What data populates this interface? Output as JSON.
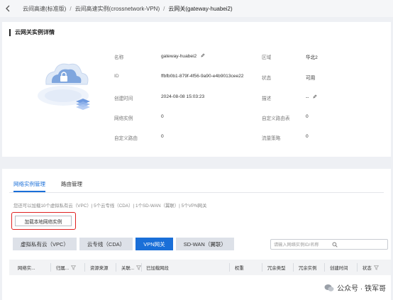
{
  "breadcrumb": {
    "items": [
      "云间高速(标准版)",
      "云间高速实例(crossnetwork-VPN)",
      "云网关(gateway-huabei2)"
    ],
    "separator": "/"
  },
  "details": {
    "title": "云网关实例详情",
    "fields": {
      "name": {
        "label": "名称",
        "value": "gateway-huabei2"
      },
      "region": {
        "label": "区域",
        "value": "华北2"
      },
      "id": {
        "label": "ID",
        "value": "ffbfb0b1-879f-4f56-9a90-e4b9013cee22"
      },
      "status": {
        "label": "状态",
        "value": "可用"
      },
      "created": {
        "label": "创建时间",
        "value": "2024-08-08 15:03:23"
      },
      "desc": {
        "label": "描述",
        "value": "--"
      },
      "net_instance": {
        "label": "网络实例",
        "value": "0"
      },
      "custom_route_table": {
        "label": "自定义路由表",
        "value": "0"
      },
      "custom_route": {
        "label": "自定义路由",
        "value": "0"
      },
      "flow_policy": {
        "label": "流量策略",
        "value": "0"
      }
    }
  },
  "tabs": [
    {
      "label": "网络实例管理",
      "active": true
    },
    {
      "label": "路由管理",
      "active": false
    }
  ],
  "quota_text": "您还可以加载10个虚拟私有云（VPC）| 5个云专线（CDA）| 1个SD-WAN（翼联）| 5个VPN网关",
  "add_button": "加载本地网络实例",
  "filters": [
    {
      "label": "虚拟私有云（VPC）",
      "active": false
    },
    {
      "label": "云专线（CDA）",
      "active": false
    },
    {
      "label": "VPN网关",
      "active": true
    },
    {
      "label": "SD-WAN（翼联）",
      "active": false
    }
  ],
  "search": {
    "placeholder": "请输入网络实例ID/名称"
  },
  "table": {
    "columns": [
      "网络实...",
      "归属...",
      "资源来源",
      "关联...",
      "已加载网段",
      "权重",
      "冗余类型",
      "冗余实例",
      "创建时间",
      "状态"
    ]
  },
  "watermark": {
    "text": "公众号 · 铁军哥"
  },
  "colors": {
    "accent": "#1a6fd8",
    "highlight": "#e02020"
  }
}
